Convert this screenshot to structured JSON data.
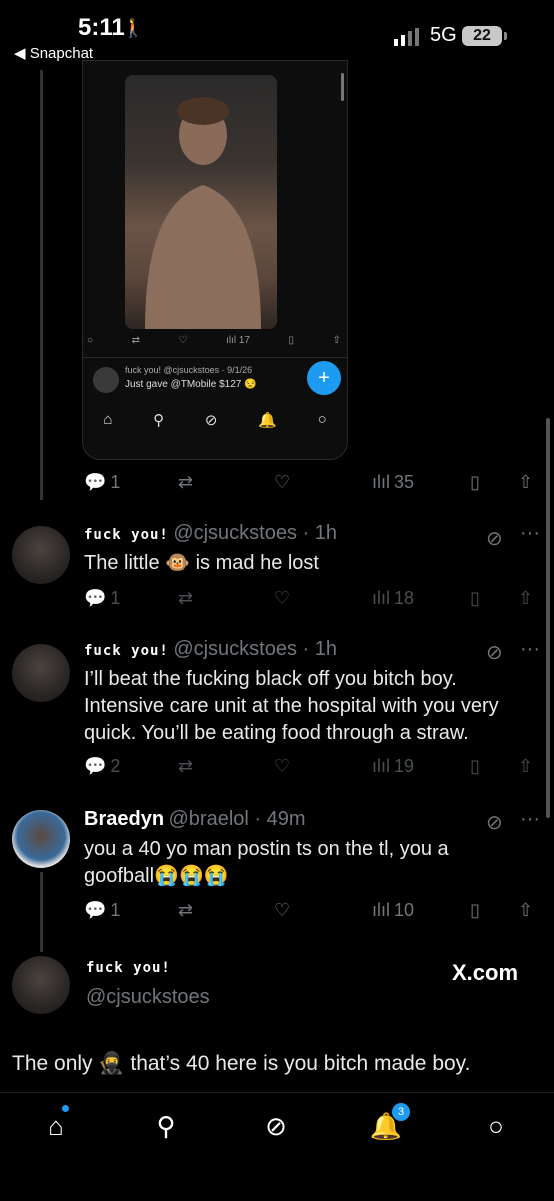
{
  "status_bar": {
    "time": "5:11",
    "back_app": "◀ Snapchat",
    "network": "5G",
    "battery": "22"
  },
  "embedded_card": {
    "mini_actions": [
      "",
      "",
      "",
      "17",
      "",
      ""
    ],
    "mini_name": "fuck you! @cjsuckstoes · 9/1/26",
    "mini_text": "Just gave @TMobile $127 😒"
  },
  "main_actions": {
    "replies": "1",
    "views": "35"
  },
  "replies": [
    {
      "display_name": "fuck you!",
      "handle": "@cjsuckstoes · 1h",
      "text": "The little 🐵 is mad he lost",
      "reply_count": "1",
      "views": "18"
    },
    {
      "display_name": "fuck you!",
      "handle": "@cjsuckstoes · 1h",
      "text": "I’ll beat the fucking black off you bitch boy. Intensive care unit at the hospital with you very quick. You’ll be eating food through a straw.",
      "reply_count": "2",
      "views": "19"
    },
    {
      "display_name": "Braedyn",
      "handle": "@braelol · 49m",
      "text": "you a 40 yo man postin ts on the tl, you a goofball😭😭😭",
      "reply_count": "1",
      "views": "10"
    }
  ],
  "focused_tweet": {
    "display_name": "fuck you!",
    "handle": "@cjsuckstoes",
    "watermark": "X.com",
    "text": "The only 🥷 that’s 40 here is you bitch made boy."
  },
  "bottom_nav": {
    "notifications_badge": "3"
  },
  "colors": {
    "accent": "#1d9bf0",
    "muted": "#71767b",
    "background": "#000000"
  }
}
